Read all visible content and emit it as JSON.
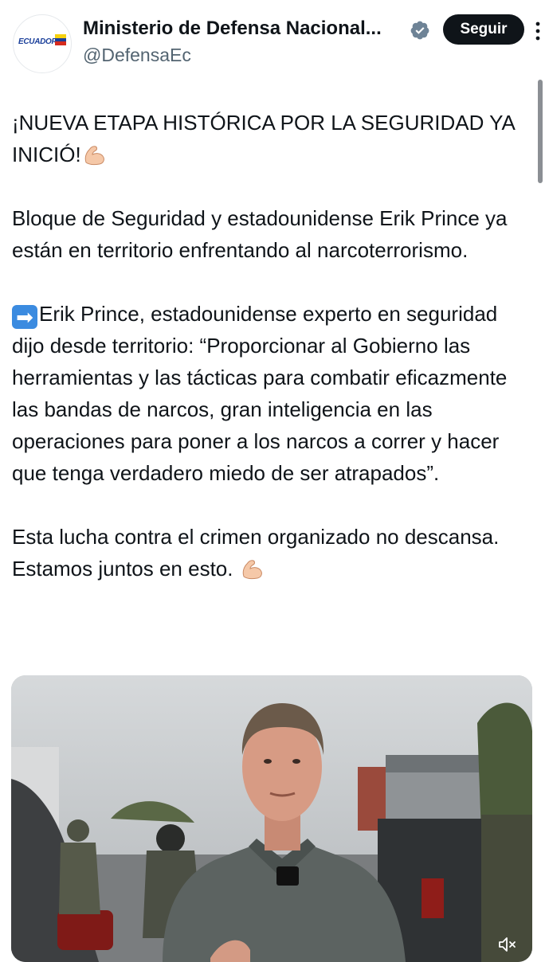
{
  "account": {
    "name": "Ministerio de Defensa Nacional...",
    "handle": "@DefensaEc",
    "avatar_text": "ECUADOR",
    "verified": true,
    "verified_color": "#6e8396"
  },
  "follow_button": {
    "label": "Seguir"
  },
  "post": {
    "paragraph_1": "¡NUEVA ETAPA HISTÓRICA POR LA SEGURIDAD YA INICIÓ!",
    "paragraph_2": "Bloque de Seguridad y estadounidense Erik Prince ya están en territorio enfrentando al narcoterrorismo.",
    "paragraph_3": "Erik Prince, estadounidense experto en seguridad dijo desde territorio: “Proporcionar al Gobierno las herramientas y las tácticas para combatir eficazmente las bandas de narcos, gran inteligencia en las operaciones para poner a los narcos a correr y hacer que tenga verdadero miedo de ser atrapados”.",
    "paragraph_4": "Esta lucha contra el crimen organizado no descansa. Estamos juntos en esto.",
    "arrow_emoji": "➡"
  },
  "media": {
    "type": "video",
    "muted": true,
    "icons": [
      "mute-icon"
    ]
  },
  "colors": {
    "text": "#0f1419",
    "secondary": "#536471",
    "button_bg": "#0f1419"
  }
}
